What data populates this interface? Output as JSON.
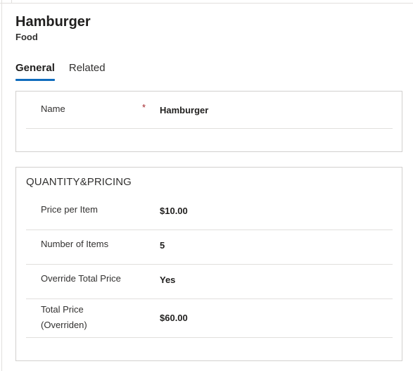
{
  "header": {
    "title": "Hamburger",
    "subtitle": "Food"
  },
  "tabs": [
    {
      "label": "General",
      "active": true
    },
    {
      "label": "Related",
      "active": false
    }
  ],
  "general_section": {
    "fields": [
      {
        "label": "Name",
        "required_marker": "*",
        "value": "Hamburger"
      }
    ]
  },
  "quantity_section": {
    "title": "QUANTITY&PRICING",
    "fields": [
      {
        "label": "Price per Item",
        "value": "$10.00"
      },
      {
        "label": "Number of Items",
        "value": "5"
      },
      {
        "label": "Override Total Price",
        "value": "Yes"
      },
      {
        "label": "Total Price\n(Overriden)",
        "value": "$60.00"
      }
    ]
  },
  "colors": {
    "accent": "#0f6cbd",
    "required": "#a4262c",
    "border": "#d2d0ce"
  }
}
